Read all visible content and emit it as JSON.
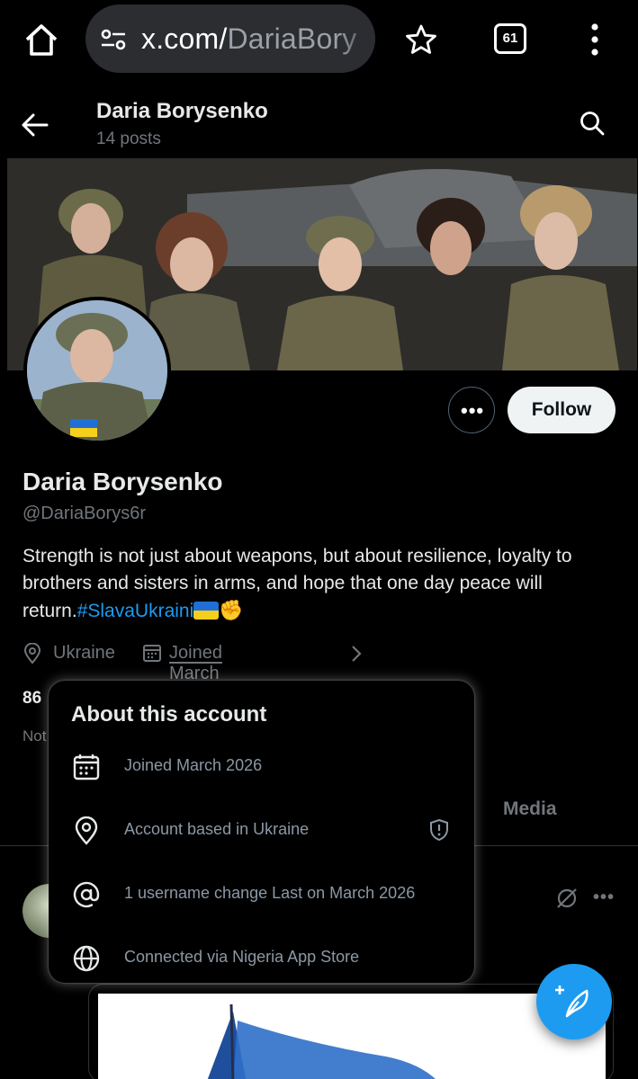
{
  "browser": {
    "url_host": "x.com/",
    "url_path": "DariaBory",
    "tab_count": "61"
  },
  "header": {
    "title": "Daria Borysenko",
    "posts_count": "14 posts"
  },
  "profile": {
    "name": "Daria Borysenko",
    "handle": "@DariaBorys6r",
    "bio_text": "Strength is not just about weapons, but about resilience, loyalty to brothers and sisters in arms, and hope that one day peace will return.",
    "bio_hashtag": "#SlavaUkraini",
    "location": "Ukraine",
    "joined": "Joined March 2026",
    "following_count_partial": "86",
    "followed_by_partial": "Not",
    "follow_label": "Follow",
    "more_label": "•••"
  },
  "tabs": {
    "media": "Media"
  },
  "about_popup": {
    "title": "About this account",
    "rows": [
      {
        "icon": "calendar-icon",
        "text": "Joined March 2026"
      },
      {
        "icon": "location-pin-icon",
        "text": "Account based in Ukraine"
      },
      {
        "icon": "at-sign-icon",
        "text": "1 username change Last on March 2026"
      },
      {
        "icon": "globe-icon",
        "text": "Connected via Nigeria App Store"
      }
    ]
  },
  "post": {
    "more_label": "•••"
  },
  "colors": {
    "accent": "#1d9bf0",
    "background": "#000000",
    "secondary_text": "#71767b"
  }
}
